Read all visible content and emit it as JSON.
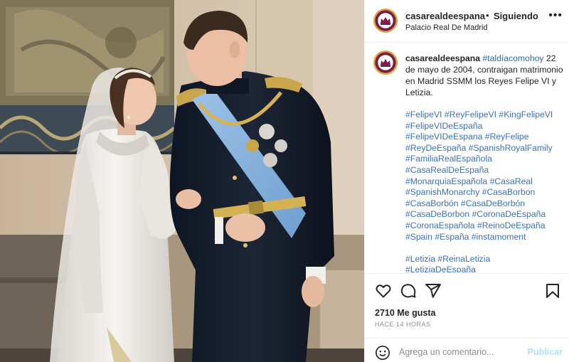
{
  "post": {
    "image_alt": "Wedding photo",
    "header": {
      "username": "casarealdeespana",
      "separator": "•",
      "follow_status": "Siguiendo",
      "location": "Palacio Real De Madrid",
      "more_icon": "more-horizontal-icon"
    },
    "caption": {
      "username": "casarealdeespana",
      "hashtag_lead": "#taldíacomohoy",
      "text": " 22 de mayo de 2004, contraigan matrimonio en Madrid SSMM los Reyes Felipe VI y Letizia.",
      "hashtag_lines": [
        "#FelipeVI #ReyFelipeVI #KingFelipeVI",
        "#FelipeVIDeEspaña",
        "#FelipeVIDeEspana #ReyFelipe",
        "#ReyDeEspaña #SpanishRoyalFamily",
        "#FamiliaRealEspañola",
        "#CasaRealDeEspaña",
        "#MonarquiaEspañola #CasaReal",
        "#SpanishMonarchy #CasaBorbon",
        "#CasaBorbón #CasaDeBorbón",
        "#CasaDeBorbon #CoronaDeEspaña",
        "#CoronaEspañola #ReinoDeEspaña",
        "#Spain #España #instamoment"
      ],
      "hashtag_lines_2": [
        "#Letizia #ReinaLetizia",
        "#LetiziaDeEspaña"
      ]
    },
    "actions": {
      "like_icon": "heart-icon",
      "comment_icon": "comment-icon",
      "share_icon": "share-icon",
      "save_icon": "bookmark-icon",
      "likes": "2710 Me gusta",
      "time": "HACE 14 HORAS"
    },
    "comment_box": {
      "emoji_icon": "emoji-icon",
      "placeholder": "Agrega un comentario...",
      "post_label": "Publicar"
    },
    "colors": {
      "hashtag": "#3a72b5",
      "publish_disabled": "#b2dffc",
      "avatar_ring": "#e0a53a"
    }
  }
}
